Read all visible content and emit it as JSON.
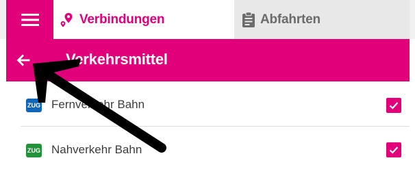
{
  "tabs": {
    "menu_icon": "hamburger-menu-icon",
    "verbindungen": {
      "label": "Verbindungen",
      "icon": "map-pin-route-icon",
      "active": true
    },
    "abfahrten": {
      "label": "Abfahrten",
      "icon": "clipboard-icon",
      "active": false
    }
  },
  "header": {
    "title": "Verkehrsmittel",
    "back_icon": "arrow-left-icon"
  },
  "transport_list": [
    {
      "badge": "ZUG",
      "badge_color": "#0f65b8",
      "label": "Fernverkehr Bahn",
      "checked": true
    },
    {
      "badge": "ZUG",
      "badge_color": "#21923a",
      "label": "Nahverkehr Bahn",
      "checked": true
    }
  ],
  "colors": {
    "accent": "#e2007a",
    "tab_inactive_bg": "#e8e8e8",
    "annotation_arrow": "#000000"
  }
}
